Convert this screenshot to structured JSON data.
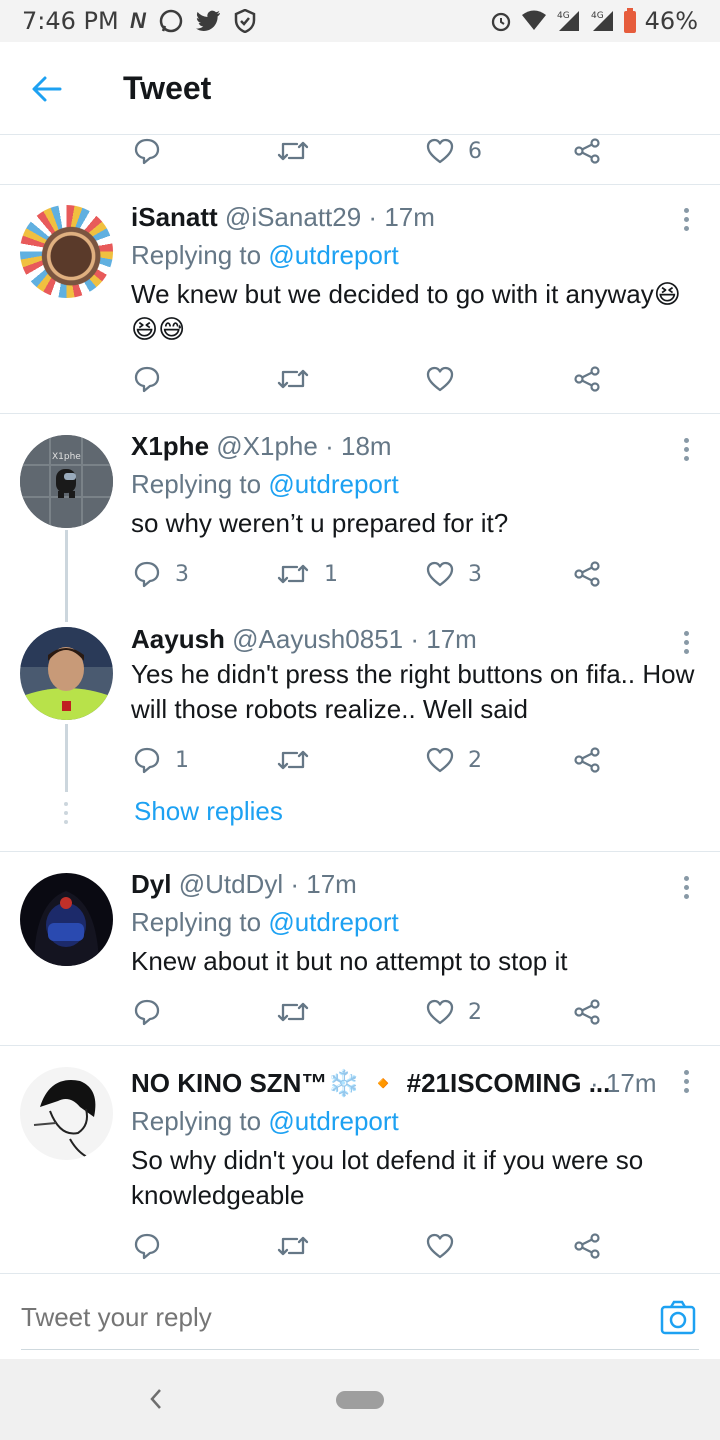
{
  "status_bar": {
    "time": "7:46 PM",
    "battery": "46%",
    "network": "4G",
    "icons_left": [
      "n-icon",
      "whatsapp-icon",
      "twitter-icon",
      "shield-icon"
    ],
    "icons_right": [
      "alarm-icon",
      "wifi-icon",
      "signal-icon",
      "signal-icon",
      "battery-icon"
    ]
  },
  "header": {
    "title": "Tweet"
  },
  "top_actions": {
    "like_count": "6"
  },
  "tweets": [
    {
      "name": "iSanatt",
      "handle": "@iSanatt29",
      "time": "17m",
      "replying_prefix": "Replying to",
      "mention": "@utdreport",
      "text": "We knew but we decided to go with it anyway😆😆😅",
      "replies": "",
      "retweets": "",
      "likes": ""
    },
    {
      "name": "X1phe",
      "handle": "@X1phe",
      "time": "18m",
      "replying_prefix": "Replying to",
      "mention": "@utdreport",
      "text": "so why weren’t u prepared for it?",
      "avatar_label": "X1phe",
      "replies": "3",
      "retweets": "1",
      "likes": "3"
    },
    {
      "name": "Aayush",
      "handle": "@Aayush0851",
      "time": "17m",
      "text": "Yes he didn't press the right buttons on fifa.. How will those robots realize.. Well said",
      "replies": "1",
      "retweets": "",
      "likes": "2"
    },
    {
      "name": "Dyl",
      "handle": "@UtdDyl",
      "time": "17m",
      "replying_prefix": "Replying to",
      "mention": "@utdreport",
      "text": "Knew about it but no attempt to stop it",
      "replies": "",
      "retweets": "",
      "likes": "2"
    },
    {
      "name": "NO KINO SZN™❄️ 🔸 #21ISCOMING ...",
      "handle": "",
      "time": "17m",
      "replying_prefix": "Replying to",
      "mention": "@utdreport",
      "text": "So why didn't you lot defend it if you were so knowledgeable",
      "replies": "",
      "retweets": "",
      "likes": ""
    }
  ],
  "show_replies": "Show replies",
  "reply_bar": {
    "placeholder": "Tweet your reply"
  },
  "colors": {
    "accent": "#1da1f2",
    "secondary_text": "#657786",
    "divider": "#e1e8ed"
  }
}
